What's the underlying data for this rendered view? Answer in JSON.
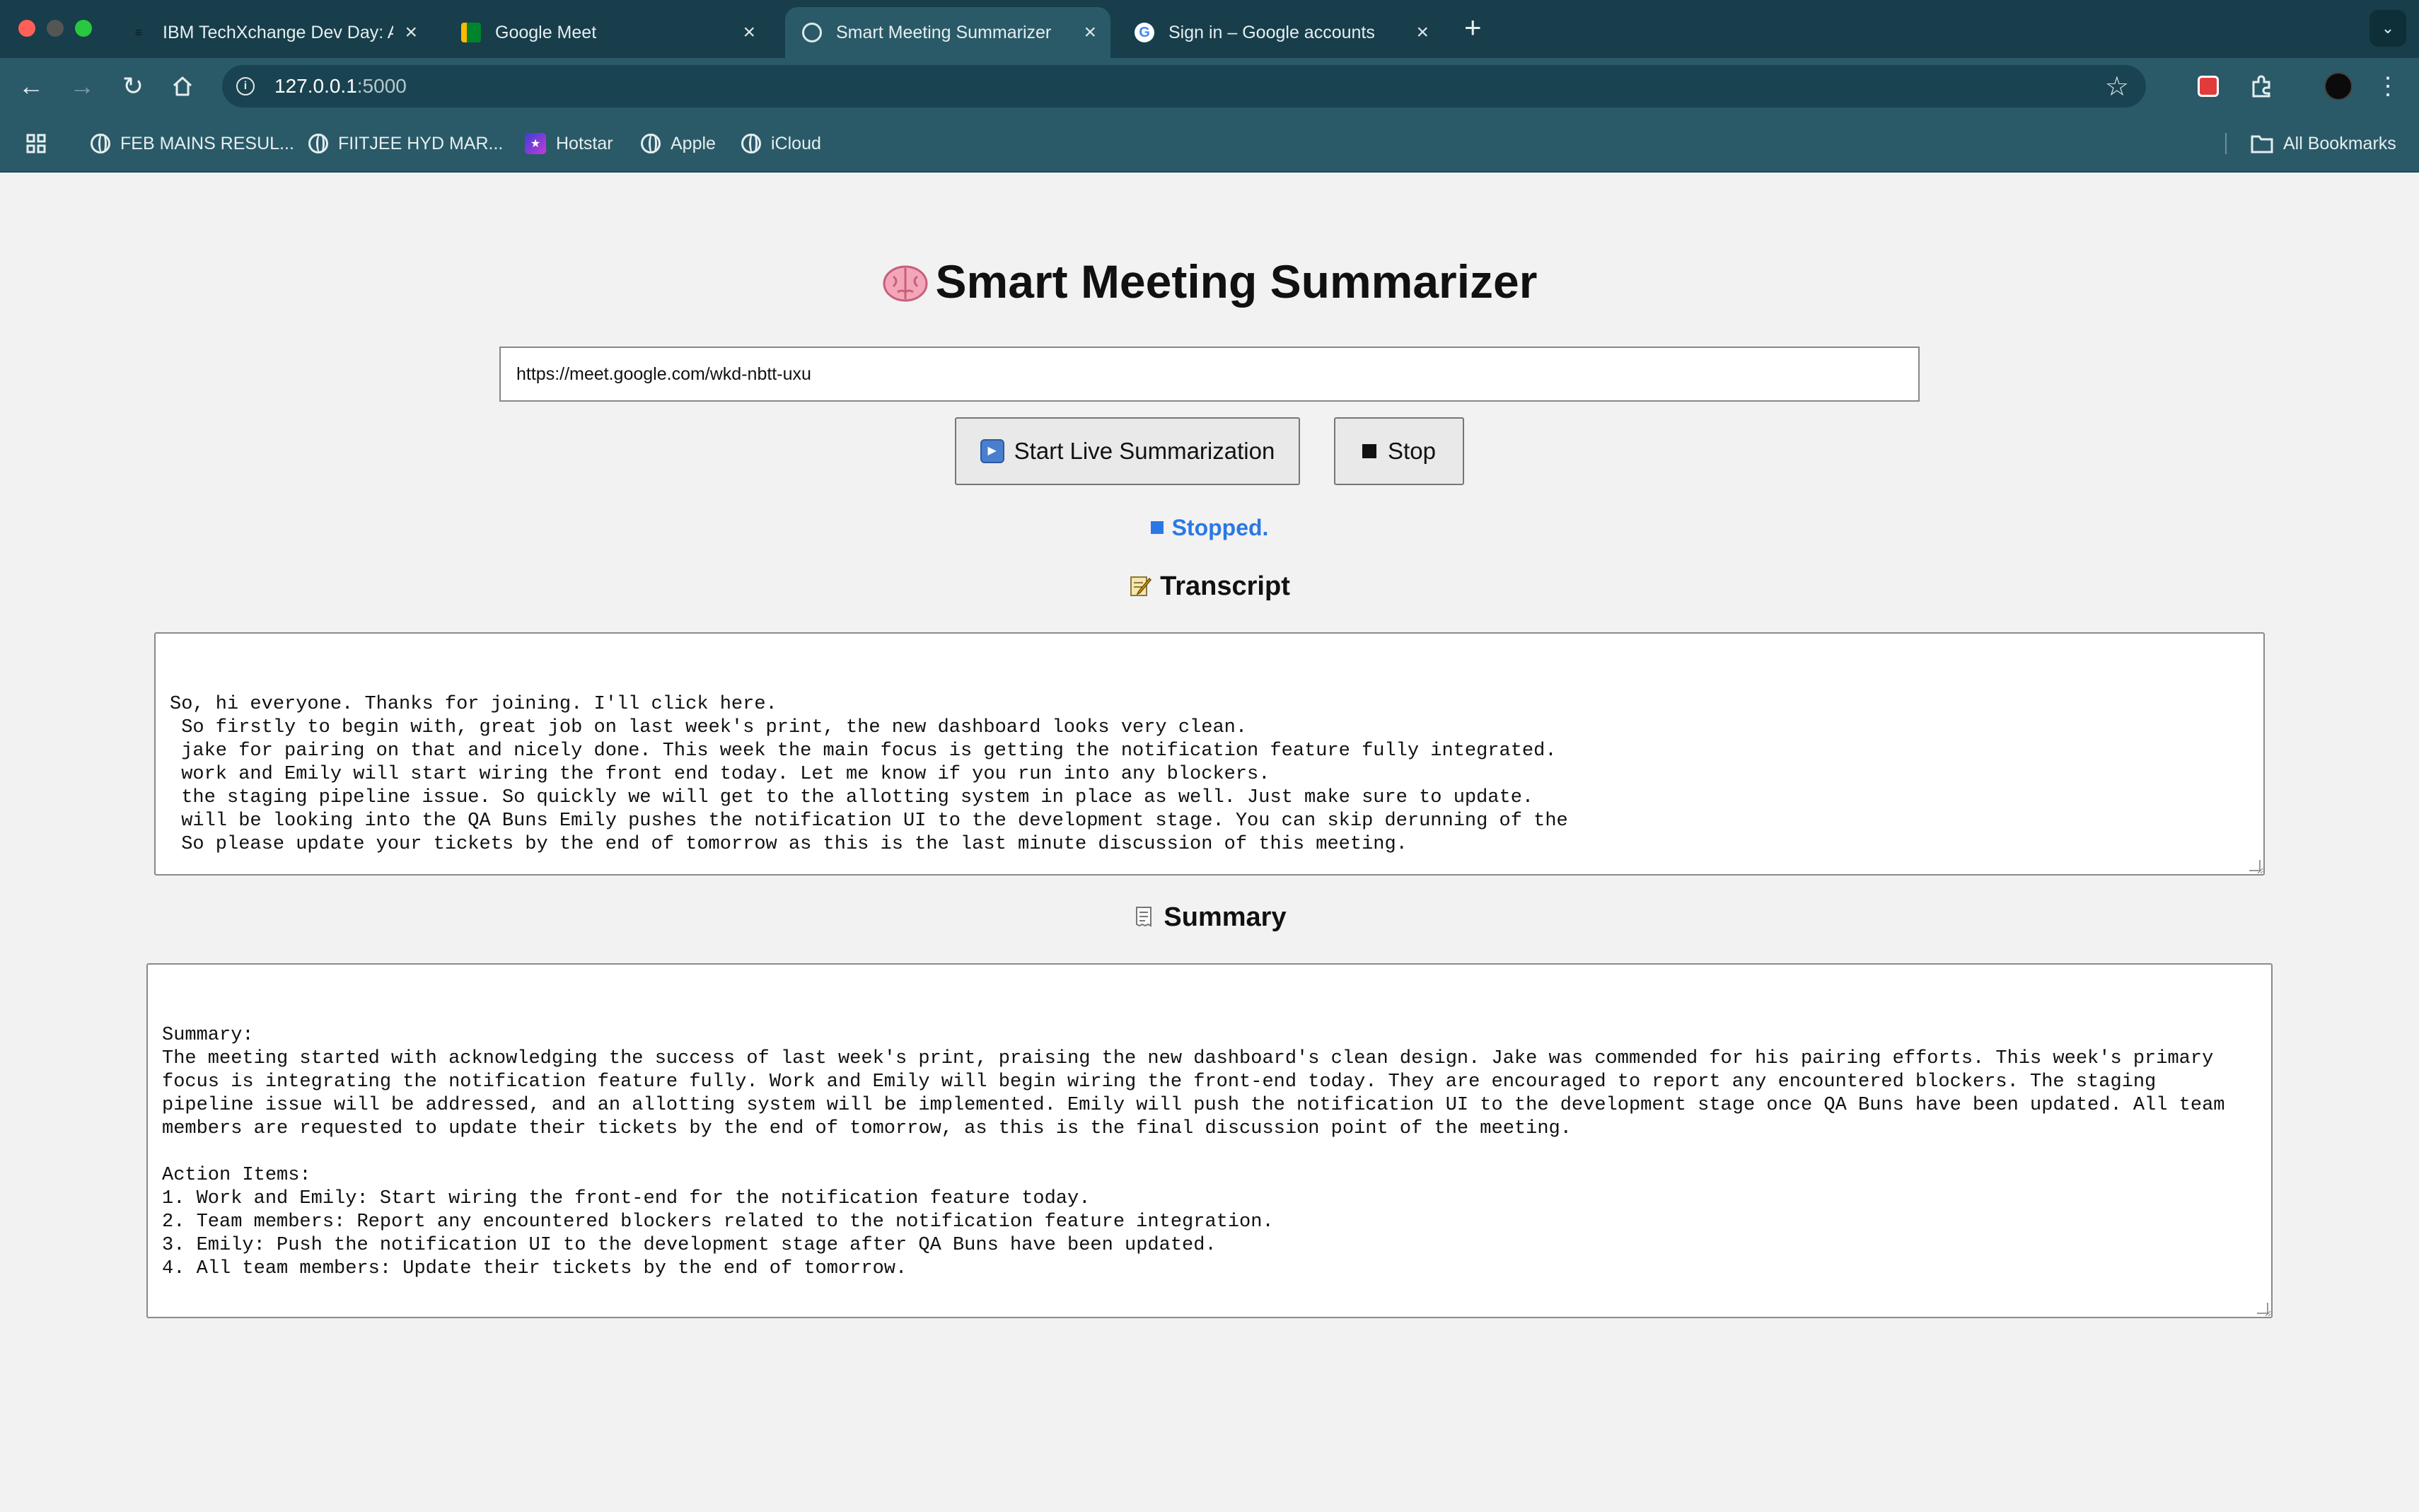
{
  "browser": {
    "tabs": [
      {
        "title": "IBM TechXchange Dev Day: A",
        "favicon": "ibm-icon",
        "active": false
      },
      {
        "title": "Google Meet",
        "favicon": "google-meet-icon",
        "active": false
      },
      {
        "title": "Smart Meeting Summarizer",
        "favicon": "globe-icon",
        "active": true
      },
      {
        "title": "Sign in – Google accounts",
        "favicon": "google-icon",
        "active": false
      }
    ],
    "new_tab": "+",
    "url": {
      "host": "127.0.0.1",
      "port": ":5000"
    },
    "bookmarks": [
      {
        "label": "FEB MAINS RESUL...",
        "icon": "globe-icon"
      },
      {
        "label": "FIITJEE HYD MAR...",
        "icon": "globe-icon"
      },
      {
        "label": "Hotstar",
        "icon": "hotstar-icon"
      },
      {
        "label": "Apple",
        "icon": "globe-icon"
      },
      {
        "label": "iCloud",
        "icon": "globe-icon"
      }
    ],
    "all_bookmarks": "All Bookmarks"
  },
  "app": {
    "title": "Smart Meeting Summarizer",
    "title_icon": "brain-emoji",
    "meet_url": "https://meet.google.com/wkd-nbtt-uxu",
    "start_button": "Start Live Summarization",
    "stop_button": "Stop",
    "status": "Stopped.",
    "transcript_heading": "Transcript",
    "transcript_text": "So, hi everyone. Thanks for joining. I'll click here.\n So firstly to begin with, great job on last week's print, the new dashboard looks very clean.\n jake for pairing on that and nicely done. This week the main focus is getting the notification feature fully integrated.\n work and Emily will start wiring the front end today. Let me know if you run into any blockers.\n the staging pipeline issue. So quickly we will get to the allotting system in place as well. Just make sure to update.\n will be looking into the QA Buns Emily pushes the notification UI to the development stage. You can skip derunning of the\n So please update your tickets by the end of tomorrow as this is the last minute discussion of this meeting.",
    "summary_heading": "Summary",
    "summary_text": "Summary:\nThe meeting started with acknowledging the success of last week's print, praising the new dashboard's clean design. Jake was commended for his pairing efforts. This week's primary focus is integrating the notification feature fully. Work and Emily will begin wiring the front-end today. They are encouraged to report any encountered blockers. The staging pipeline issue will be addressed, and an allotting system will be implemented. Emily will push the notification UI to the development stage once QA Buns have been updated. All team members are requested to update their tickets by the end of tomorrow, as this is the final discussion point of the meeting.\n\nAction Items:\n1. Work and Emily: Start wiring the front-end for the notification feature today.\n2. Team members: Report any encountered blockers related to the notification feature integration.\n3. Emily: Push the notification UI to the development stage after QA Buns have been updated.\n4. All team members: Update their tickets by the end of tomorrow."
  },
  "colors": {
    "chrome_dark": "#173e4a",
    "chrome": "#2a5a68",
    "page_bg": "#f2f2f2",
    "status_blue": "#2b78e4"
  }
}
